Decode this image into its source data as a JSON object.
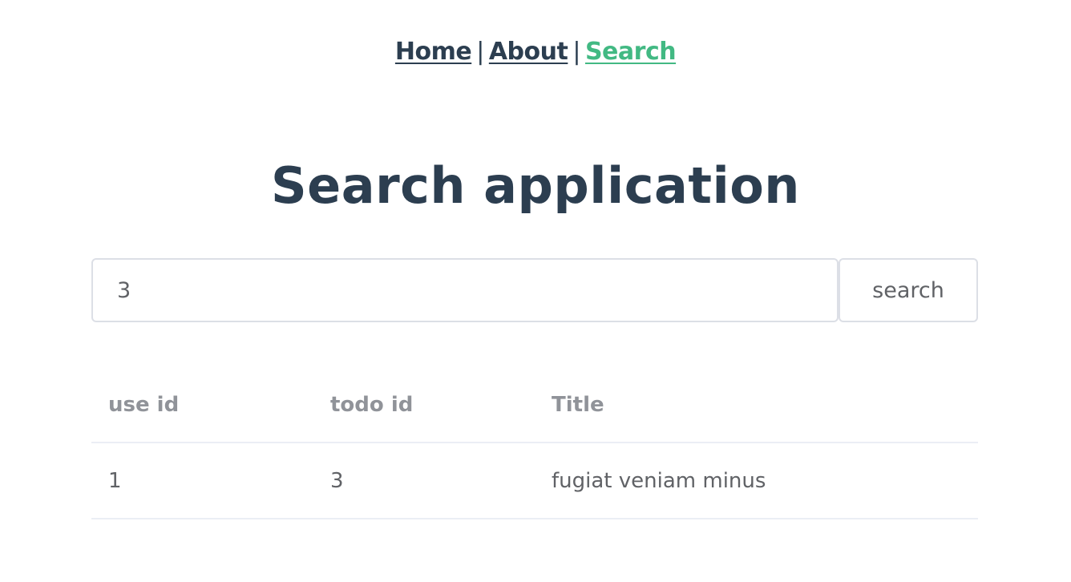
{
  "nav": {
    "items": [
      {
        "label": "Home",
        "active": false
      },
      {
        "label": "About",
        "active": false
      },
      {
        "label": "Search",
        "active": true
      }
    ],
    "separator": "|",
    "active_color": "#42b983",
    "text_color": "#2c3e50"
  },
  "page": {
    "title": "Search application"
  },
  "search": {
    "value": "3",
    "placeholder": "",
    "button_label": "search"
  },
  "table": {
    "headers": [
      "use id",
      "todo id",
      "Title"
    ],
    "rows": [
      [
        "1",
        "3",
        "fugiat veniam minus"
      ]
    ]
  }
}
